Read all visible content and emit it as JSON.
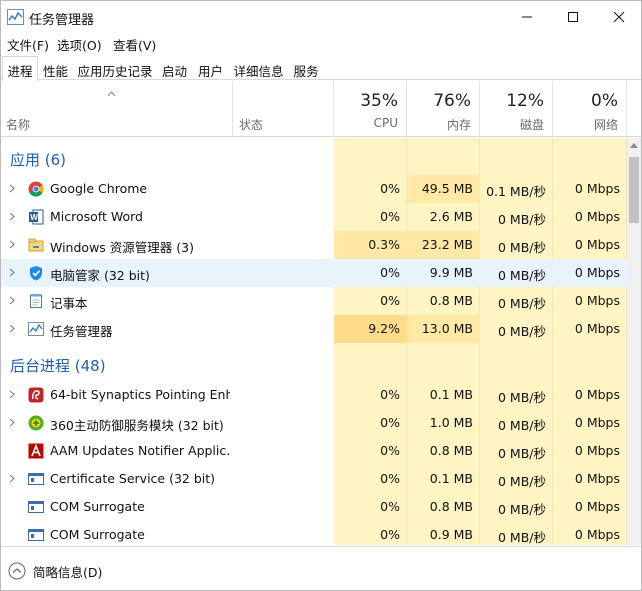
{
  "window": {
    "title": "任务管理器"
  },
  "menu": [
    "文件(F)",
    "选项(O)",
    "查看(V)"
  ],
  "tabs": [
    "进程",
    "性能",
    "应用历史记录",
    "启动",
    "用户",
    "详细信息",
    "服务"
  ],
  "header": {
    "name": "名称",
    "status": "状态",
    "cpu": {
      "pct": "35%",
      "label": "CPU"
    },
    "mem": {
      "pct": "76%",
      "label": "内存"
    },
    "disk": {
      "pct": "12%",
      "label": "磁盘"
    },
    "net": {
      "pct": "0%",
      "label": "网络"
    }
  },
  "groups": {
    "apps": "应用 (6)",
    "background": "后台进程 (48)"
  },
  "apps": [
    {
      "name": "Google Chrome",
      "cpu": "0%",
      "mem": "49.5 MB",
      "disk": "0.1 MB/秒",
      "net": "0 Mbps",
      "icon": "chrome-icon"
    },
    {
      "name": "Microsoft Word",
      "cpu": "0%",
      "mem": "2.6 MB",
      "disk": "0 MB/秒",
      "net": "0 Mbps",
      "icon": "word-icon"
    },
    {
      "name": "Windows 资源管理器 (3)",
      "cpu": "0.3%",
      "mem": "23.2 MB",
      "disk": "0 MB/秒",
      "net": "0 Mbps",
      "icon": "explorer-icon"
    },
    {
      "name": "电脑管家 (32 bit)",
      "cpu": "0%",
      "mem": "9.9 MB",
      "disk": "0 MB/秒",
      "net": "0 Mbps",
      "icon": "shield-icon"
    },
    {
      "name": "记事本",
      "cpu": "0%",
      "mem": "0.8 MB",
      "disk": "0 MB/秒",
      "net": "0 Mbps",
      "icon": "notepad-icon"
    },
    {
      "name": "任务管理器",
      "cpu": "9.2%",
      "mem": "13.0 MB",
      "disk": "0 MB/秒",
      "net": "0 Mbps",
      "icon": "taskmgr-icon"
    }
  ],
  "background": [
    {
      "name": "64-bit Synaptics Pointing Enh...",
      "cpu": "0%",
      "mem": "0.1 MB",
      "disk": "0 MB/秒",
      "net": "0 Mbps",
      "icon": "synaptics-icon"
    },
    {
      "name": "360主动防御服务模块 (32 bit)",
      "cpu": "0%",
      "mem": "1.0 MB",
      "disk": "0 MB/秒",
      "net": "0 Mbps",
      "icon": "360-icon"
    },
    {
      "name": "AAM Updates Notifier Applic...",
      "cpu": "0%",
      "mem": "0.8 MB",
      "disk": "0 MB/秒",
      "net": "0 Mbps",
      "icon": "adobe-icon"
    },
    {
      "name": "Certificate Service (32 bit)",
      "cpu": "0%",
      "mem": "0.1 MB",
      "disk": "0 MB/秒",
      "net": "0 Mbps",
      "icon": "service-window-icon"
    },
    {
      "name": "COM Surrogate",
      "cpu": "0%",
      "mem": "0.8 MB",
      "disk": "0 MB/秒",
      "net": "0 Mbps",
      "icon": "service-window-icon"
    },
    {
      "name": "COM Surrogate",
      "cpu": "0%",
      "mem": "0.9 MB",
      "disk": "0 MB/秒",
      "net": "0 Mbps",
      "icon": "service-window-icon"
    }
  ],
  "footer": {
    "label": "简略信息(D)"
  },
  "colors": {
    "group": "#1f5fa9",
    "heat_low": "#fff4c4",
    "heat_mid": "#ffe9a5",
    "heat_high": "#ffdc8a",
    "hover": "#e8f3fb"
  }
}
